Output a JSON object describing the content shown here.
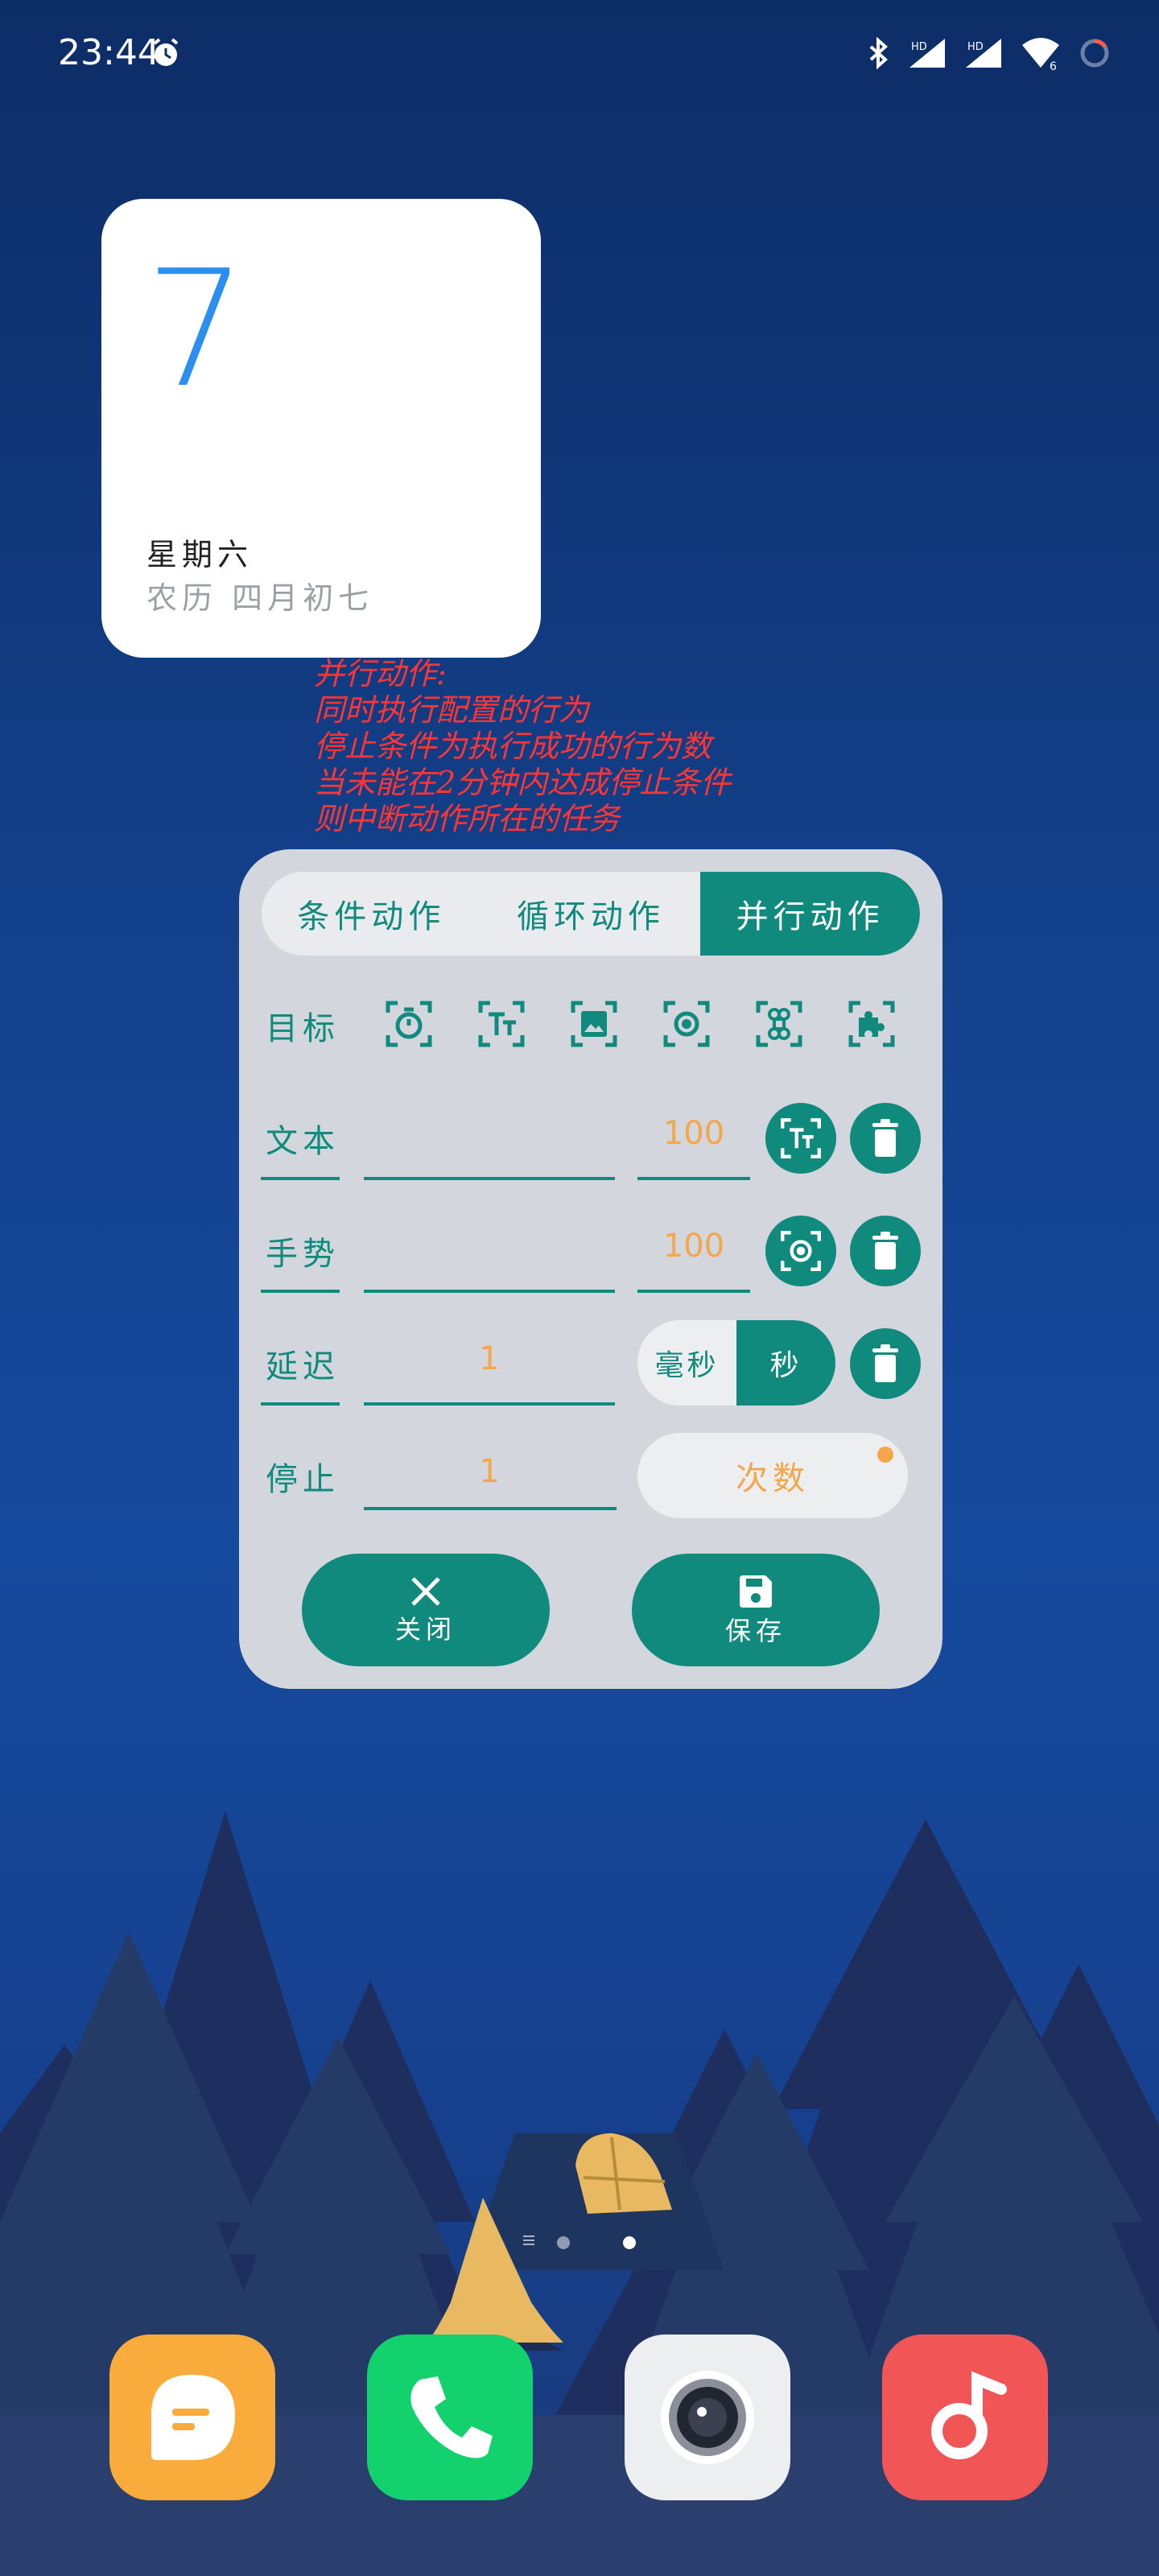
{
  "status_bar": {
    "time": "23:44",
    "icons": [
      "alarm-icon",
      "bluetooth-icon",
      "signal-hd-1-icon",
      "signal-hd-2-icon",
      "wifi-icon",
      "battery-icon"
    ],
    "wifi_badge": "6"
  },
  "calendar_widget": {
    "day": "7",
    "weekday": "星期六",
    "lunar": "农历 四月初七",
    "accent": "#2b8ff0"
  },
  "annotation": {
    "lines": [
      "并行动作:",
      "同时执行配置的行为",
      "停止条件为执行成功的行为数",
      "当未能在2分钟内达成停止条件",
      "则中断动作所在的任务"
    ],
    "color": "#ff3535"
  },
  "dialog": {
    "accent": "#0f8a7c",
    "tabs": [
      "条件动作",
      "循环动作",
      "并行动作"
    ],
    "active_tab": "并行动作",
    "target_label": "目标",
    "target_icons": [
      "timer-icon",
      "text-icon",
      "image-icon",
      "gesture-target-icon",
      "command-icon",
      "plugin-icon"
    ],
    "rows": {
      "text": {
        "label": "文本",
        "value": "",
        "number": "100"
      },
      "gesture": {
        "label": "手势",
        "value": "",
        "number": "100"
      },
      "delay": {
        "label": "延迟",
        "value": "1",
        "unit_options": [
          "毫秒",
          "秒"
        ],
        "unit_selected": "秒"
      },
      "stop": {
        "label": "停止",
        "value": "1",
        "mode": "次数"
      }
    },
    "close_label": "关闭",
    "save_label": "保存"
  },
  "home": {
    "page_indicator": [
      "menu",
      "page-1",
      "page-2"
    ],
    "current_page": 2,
    "dock_apps": [
      "messages-app-icon",
      "phone-app-icon",
      "camera-app-icon",
      "music-app-icon"
    ]
  }
}
